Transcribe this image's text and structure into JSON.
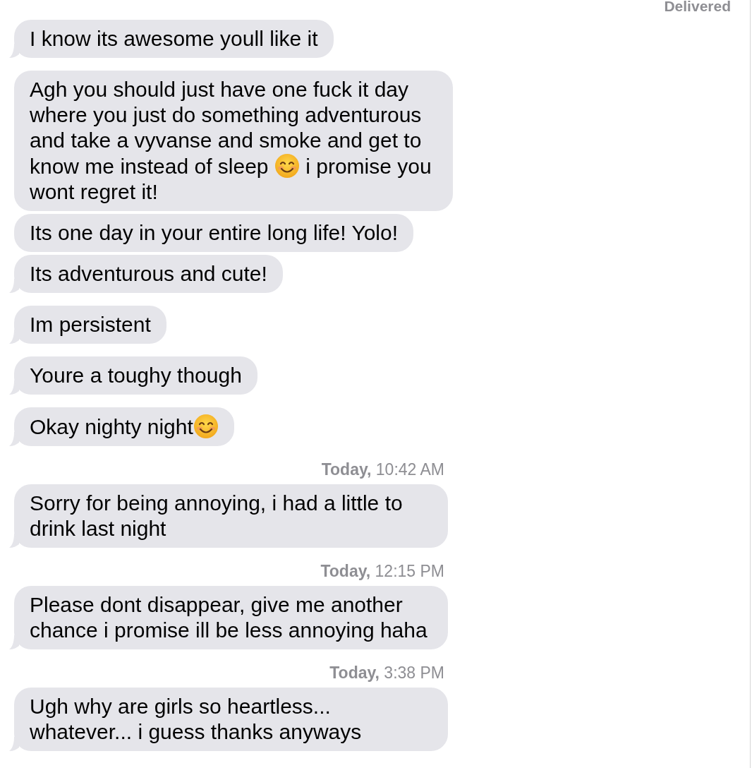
{
  "status": "Delivered",
  "thread": [
    {
      "kind": "message",
      "tail": true,
      "segments": [
        {
          "kind": "text",
          "text": "I know its awesome youll like it"
        }
      ]
    },
    {
      "kind": "message",
      "tail": false,
      "segments": [
        {
          "kind": "text",
          "text": "Agh you should just have one fuck it day where you just do something adventurous and take a vyvanse and smoke and get to know me instead of sleep "
        },
        {
          "kind": "emoji"
        },
        {
          "kind": "text",
          "text": " i promise you wont regret it!"
        }
      ]
    },
    {
      "kind": "message",
      "tail": false,
      "segments": [
        {
          "kind": "text",
          "text": "Its one day in your entire long life! Yolo!"
        }
      ]
    },
    {
      "kind": "message",
      "tail": true,
      "segments": [
        {
          "kind": "text",
          "text": "Its adventurous and cute!"
        }
      ]
    },
    {
      "kind": "message",
      "tail": true,
      "segments": [
        {
          "kind": "text",
          "text": "Im persistent"
        }
      ]
    },
    {
      "kind": "message",
      "tail": true,
      "segments": [
        {
          "kind": "text",
          "text": "Youre a toughy though"
        }
      ]
    },
    {
      "kind": "message",
      "tail": true,
      "segments": [
        {
          "kind": "text",
          "text": "Okay nighty night"
        },
        {
          "kind": "emoji"
        }
      ]
    },
    {
      "kind": "timestamp",
      "text": "**Today,** 10:42 AM"
    },
    {
      "kind": "message",
      "tail": true,
      "segments": [
        {
          "kind": "text",
          "text": "Sorry for being annoying, i had a little to drink last night"
        }
      ]
    },
    {
      "kind": "timestamp",
      "text": "**Today,** 12:15 PM"
    },
    {
      "kind": "message",
      "tail": true,
      "segments": [
        {
          "kind": "text",
          "text": "Please dont disappear, give me another chance i promise ill be less annoying haha"
        }
      ]
    },
    {
      "kind": "timestamp",
      "text": "**Today,** 3:38 PM"
    },
    {
      "kind": "message",
      "tail": true,
      "segments": [
        {
          "kind": "text",
          "text": "Ugh why are girls so heartless... whatever... i guess thanks anyways"
        }
      ]
    }
  ]
}
